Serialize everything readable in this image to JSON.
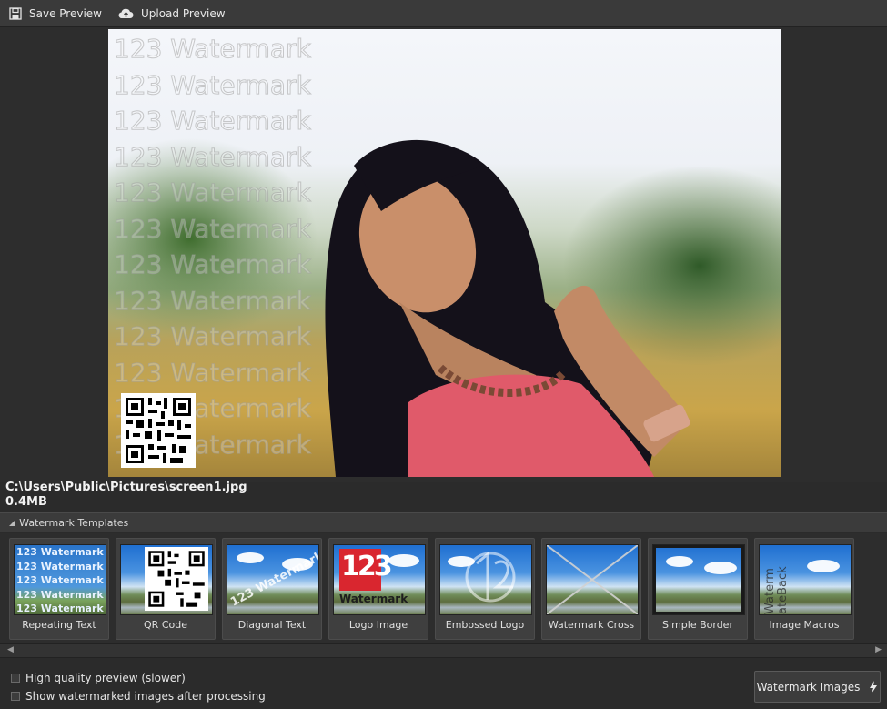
{
  "toolbar": {
    "save_label": "Save Preview",
    "upload_label": "Upload Preview"
  },
  "preview": {
    "watermark_lines": [
      "123 Watermark",
      "123 Watermark",
      "123 Watermark",
      "123 Watermark",
      "123 Watermark",
      "123 Watermark",
      "123 Watermark",
      "123 Watermark",
      "123 Watermark",
      "123 Watermark",
      "123 Watermark",
      "123 Watermark"
    ]
  },
  "file": {
    "path": "C:\\Users\\Public\\Pictures\\screen1.jpg",
    "size": "0.4MB"
  },
  "templates": {
    "header": "Watermark Templates",
    "items": [
      {
        "label": "Repeating Text",
        "thumb_text": "123 Watermark"
      },
      {
        "label": "QR Code"
      },
      {
        "label": "Diagonal Text",
        "thumb_text": "123 Watermark"
      },
      {
        "label": "Logo Image",
        "logo_number": "123",
        "logo_word": "Watermark"
      },
      {
        "label": "Embossed Logo"
      },
      {
        "label": "Watermark Cross"
      },
      {
        "label": "Simple Border"
      },
      {
        "label": "Image Macros",
        "thumb_text_1": "Waterm",
        "thumb_text_2": "ateBack"
      }
    ]
  },
  "options": {
    "high_quality_label": "High quality preview (slower)",
    "show_after_label": "Show watermarked images after processing"
  },
  "action": {
    "watermark_label": "Watermark Images"
  }
}
